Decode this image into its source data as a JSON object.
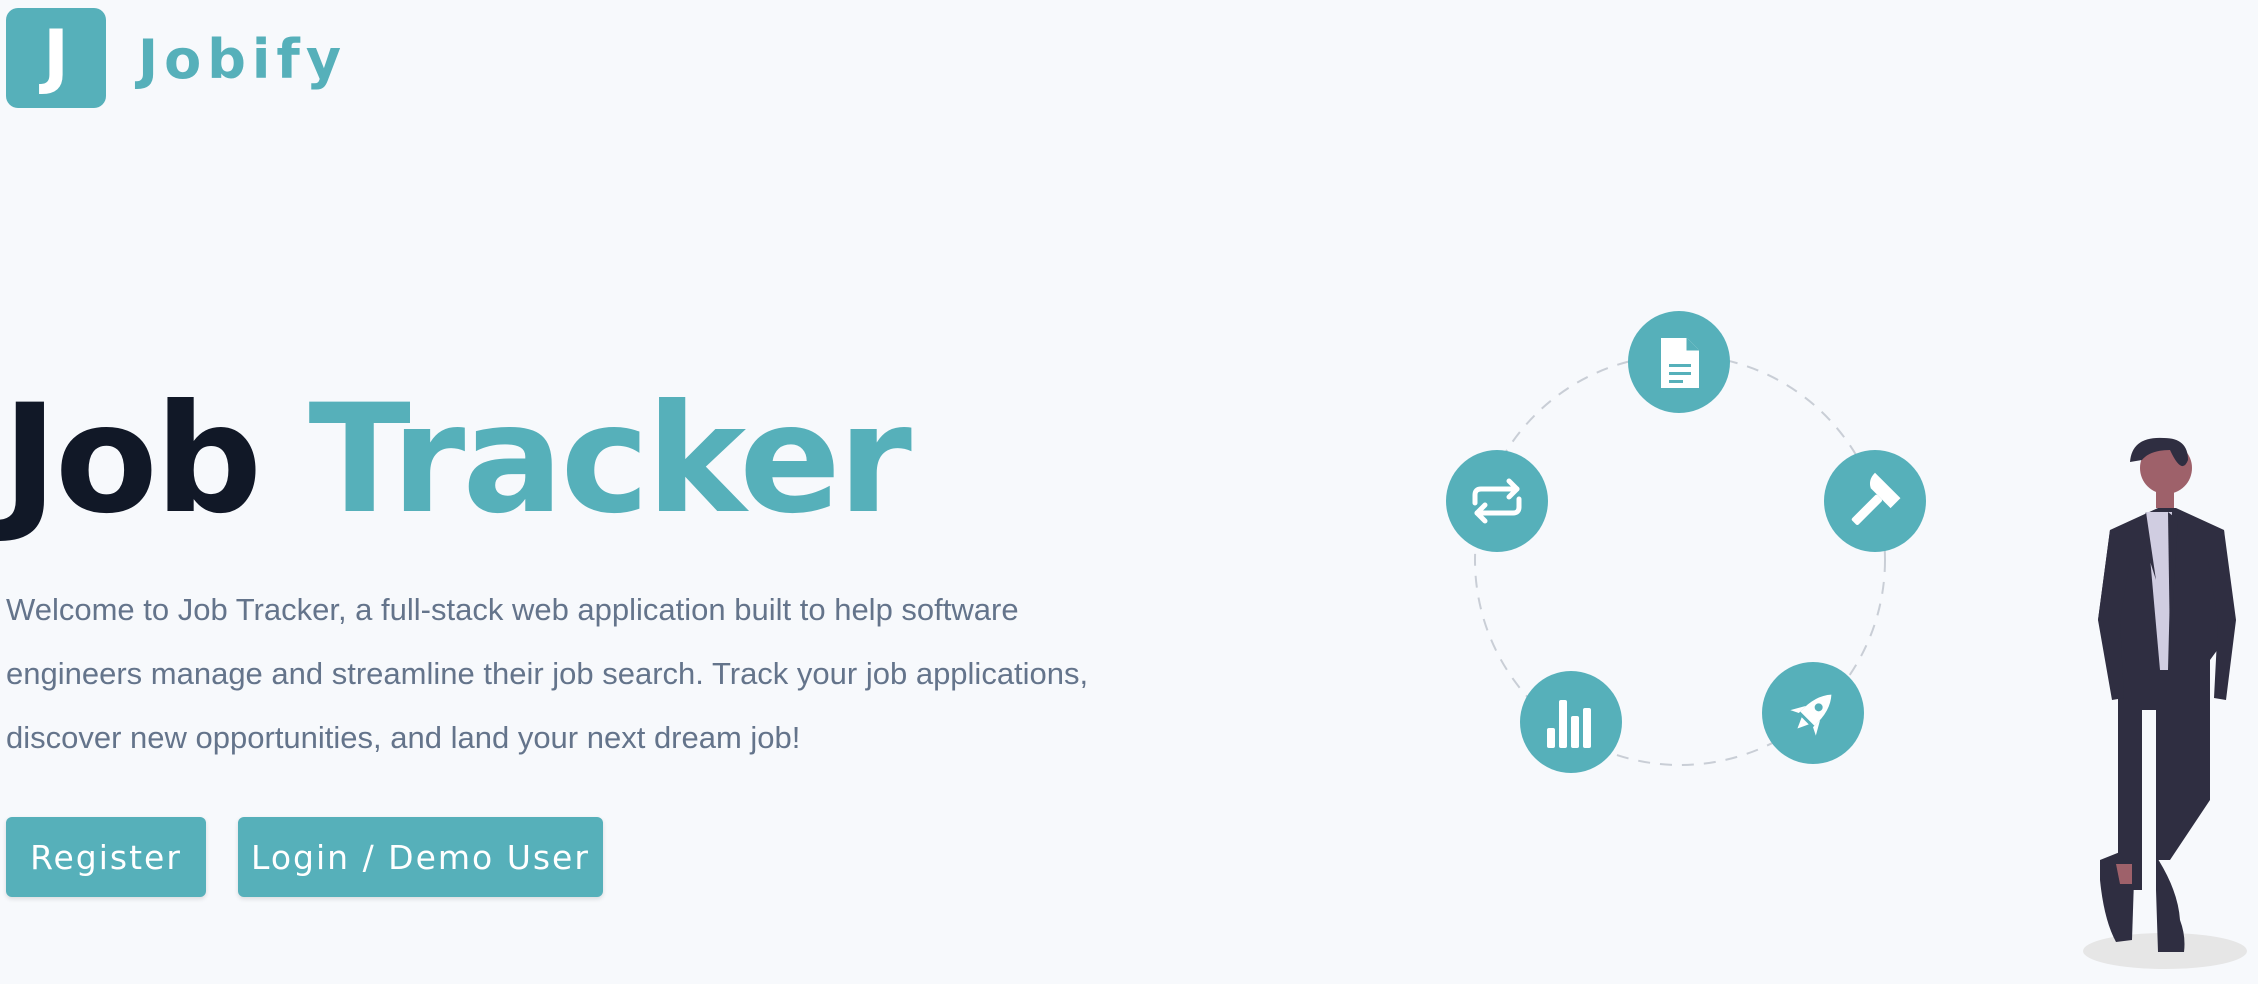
{
  "brand": {
    "logo_letter": "J",
    "name": "Jobify"
  },
  "hero": {
    "title_part1": "Job",
    "title_part2": "Tracker",
    "description": "Welcome to Job Tracker, a full-stack web application built to help software engineers manage and streamline their job search. Track your job applications, discover new opportunities, and land your next dream job!"
  },
  "buttons": {
    "register": "Register",
    "login": "Login / Demo User"
  },
  "illustration": {
    "icons": [
      "document-icon",
      "hammer-icon",
      "rocket-icon",
      "bar-chart-icon",
      "repeat-icon"
    ]
  },
  "colors": {
    "accent": "#56b0ba",
    "heading": "#111827",
    "body_text": "#64748b",
    "background": "#f7f9fc"
  }
}
